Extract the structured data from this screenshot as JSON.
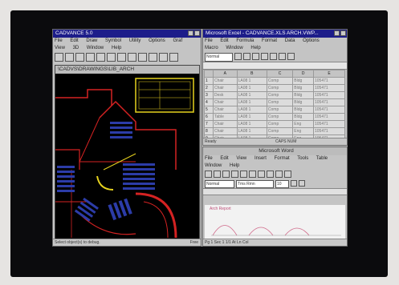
{
  "cad": {
    "title": "CADVANCE 5.0",
    "menu_row1": [
      "File",
      "Edit",
      "Draw",
      "Symbol",
      "Utility",
      "Options",
      "Graf"
    ],
    "menu_row2": [
      "View",
      "3D",
      "Window",
      "Help"
    ],
    "doc_title": "\\CADVS\\DRAWINGS\\LIB_ARCH",
    "status_text": "Select object(s) to debug.",
    "status_right": "Free"
  },
  "excel": {
    "title": "Microsoft Excel - CADVANCE.XLS ARCH.VWP...",
    "menu_row1": [
      "File",
      "Edit",
      "Formula",
      "Format",
      "Data",
      "Options"
    ],
    "menu_row2": [
      "Macro",
      "Window",
      "Help"
    ],
    "style_box": "Normal",
    "columns": [
      "A",
      "B",
      "C",
      "D",
      "E"
    ],
    "rows": [
      [
        "Chair",
        "LA08 1",
        "Comp",
        "Bldg",
        "105471"
      ],
      [
        "Chair",
        "LA08 1",
        "Comp",
        "Bldg",
        "105471"
      ],
      [
        "Desk",
        "LA08 1",
        "Comp",
        "Bldg",
        "105471"
      ],
      [
        "Chair",
        "LA08 1",
        "Comp",
        "Bldg",
        "105471"
      ],
      [
        "Chair",
        "LA08 1",
        "Comp",
        "Bldg",
        "105471"
      ],
      [
        "Table",
        "LA08 1",
        "Comp",
        "Bldg",
        "105471"
      ],
      [
        "Chair",
        "LA08 1",
        "Comp",
        "Eng",
        "105471"
      ],
      [
        "Chair",
        "LA08 1",
        "Comp",
        "Eng",
        "105471"
      ],
      [
        "Chair",
        "LA08 1",
        "Comp",
        "Eng",
        "105471"
      ]
    ],
    "status": "Ready",
    "status_right": "CAPS NUM"
  },
  "word": {
    "title": "Microsoft Word",
    "menu_row1": [
      "File",
      "Edit",
      "View",
      "Insert",
      "Format",
      "Tools",
      "Table"
    ],
    "menu_row2": [
      "Window",
      "Help"
    ],
    "style_box": "Normal",
    "font_box": "Tms Rmn",
    "size_box": "10",
    "doc_heading": "Arch Report",
    "status_text": "Pg 1   Sec 1   1/1   At   Ln   Col"
  },
  "colors": {
    "titlebar": "#1d1d8a",
    "cad_background": "#000000",
    "cad_lines_red": "#d42222",
    "cad_lines_blue": "#2c3ca8",
    "cad_lines_yellow": "#e6d21e"
  }
}
